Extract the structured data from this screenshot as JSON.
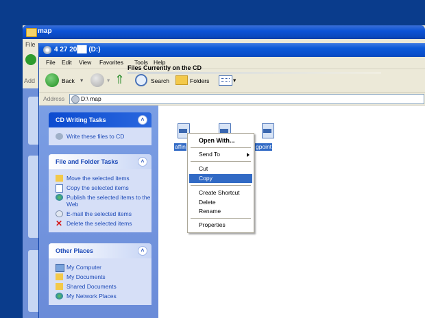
{
  "background_window": {
    "title": "map",
    "menu_stub": "File",
    "address_stub": "Add"
  },
  "window": {
    "title": "4 27 20██ (D:)"
  },
  "menubar": [
    "File",
    "Edit",
    "View",
    "Favorites",
    "Tools",
    "Help"
  ],
  "toolbar": {
    "back_label": "Back",
    "search_label": "Search",
    "folders_label": "Folders"
  },
  "addressbar": {
    "label": "Address",
    "value": "D:\\ map"
  },
  "task_pane": {
    "cd_writing": {
      "title": "CD Writing Tasks",
      "items": [
        "Write these files to CD"
      ]
    },
    "file_folder": {
      "title": "File and Folder Tasks",
      "items": [
        "Move the selected items",
        "Copy the selected items",
        "Publish the selected items to the Web",
        "E-mail the selected items",
        "Delete the selected items"
      ]
    },
    "other_places": {
      "title": "Other Places",
      "items": [
        "My Computer",
        "My Documents",
        "Shared Documents",
        "My Network Places"
      ]
    }
  },
  "file_area": {
    "heading": "Files Currently on the CD",
    "files": [
      {
        "name": "affin"
      },
      {
        "name": ""
      },
      {
        "name": "gpoint"
      }
    ]
  },
  "context_menu": {
    "items": [
      {
        "label": "Open With...",
        "bold": true
      },
      {
        "label": "Send To",
        "submenu": true
      },
      {
        "label": "Cut"
      },
      {
        "label": "Copy",
        "selected": true
      },
      {
        "label": "Create Shortcut"
      },
      {
        "label": "Delete"
      },
      {
        "label": "Rename"
      },
      {
        "label": "Properties"
      }
    ]
  },
  "colors": {
    "desktop": "#0a3c8c",
    "titlebar": "#0a4fcc",
    "selection": "#316ac5",
    "task_pane": "#7b9ee4",
    "link_text": "#1d4ab7"
  }
}
